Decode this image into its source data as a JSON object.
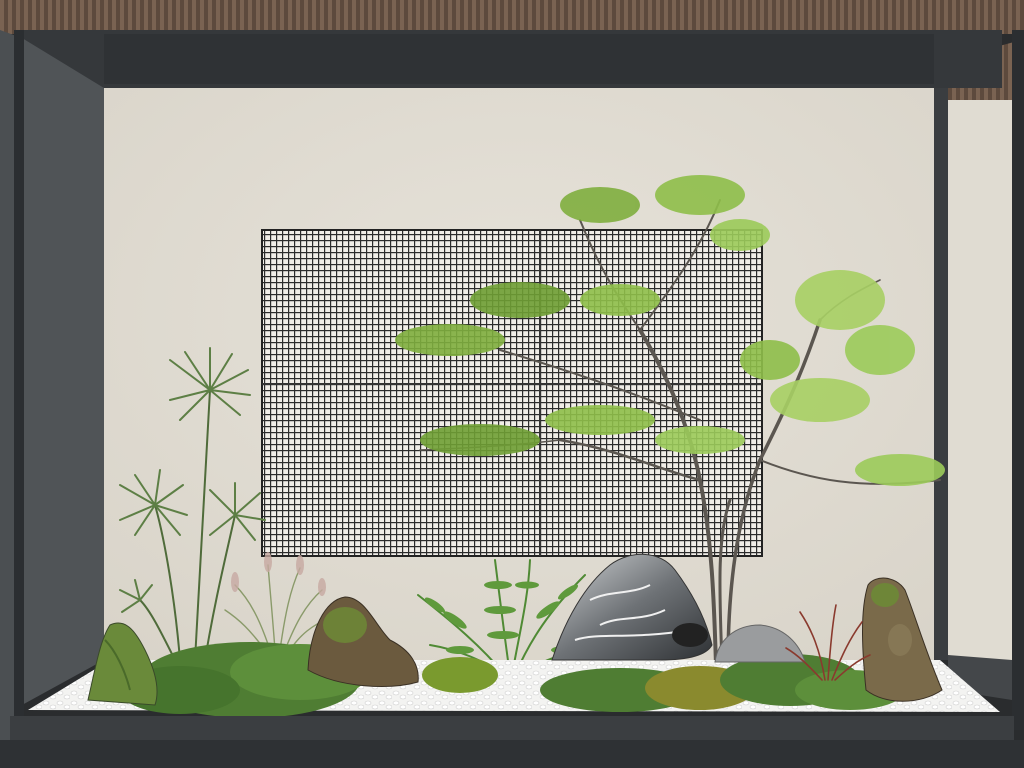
{
  "scene": {
    "description_hidden": "",
    "colors": {
      "frame_dark": "#2f3133",
      "frame_mid": "#3d4043",
      "wall": "#e2ddd3",
      "wall_shade": "#d6d1c6",
      "side_wall": "#4a4d50",
      "slats": "#6b5646",
      "grid_bg": "#efece6",
      "grid_line": "#2a2a2a",
      "gravel": "#f4f4f2",
      "moss": "#5a8a3a",
      "moss_dark": "#3f6b2a",
      "leaf": "#8fbf4a",
      "leaf_dark": "#5f8f2e",
      "rock_grey": "#8a8d90",
      "rock_brown": "#6b5a3e"
    },
    "icons": [
      "maple-tree",
      "papyrus-plant",
      "fern",
      "ornamental-grass",
      "red-grass",
      "scholar-rock",
      "moss-rock",
      "white-gravel",
      "grid-screen"
    ]
  }
}
